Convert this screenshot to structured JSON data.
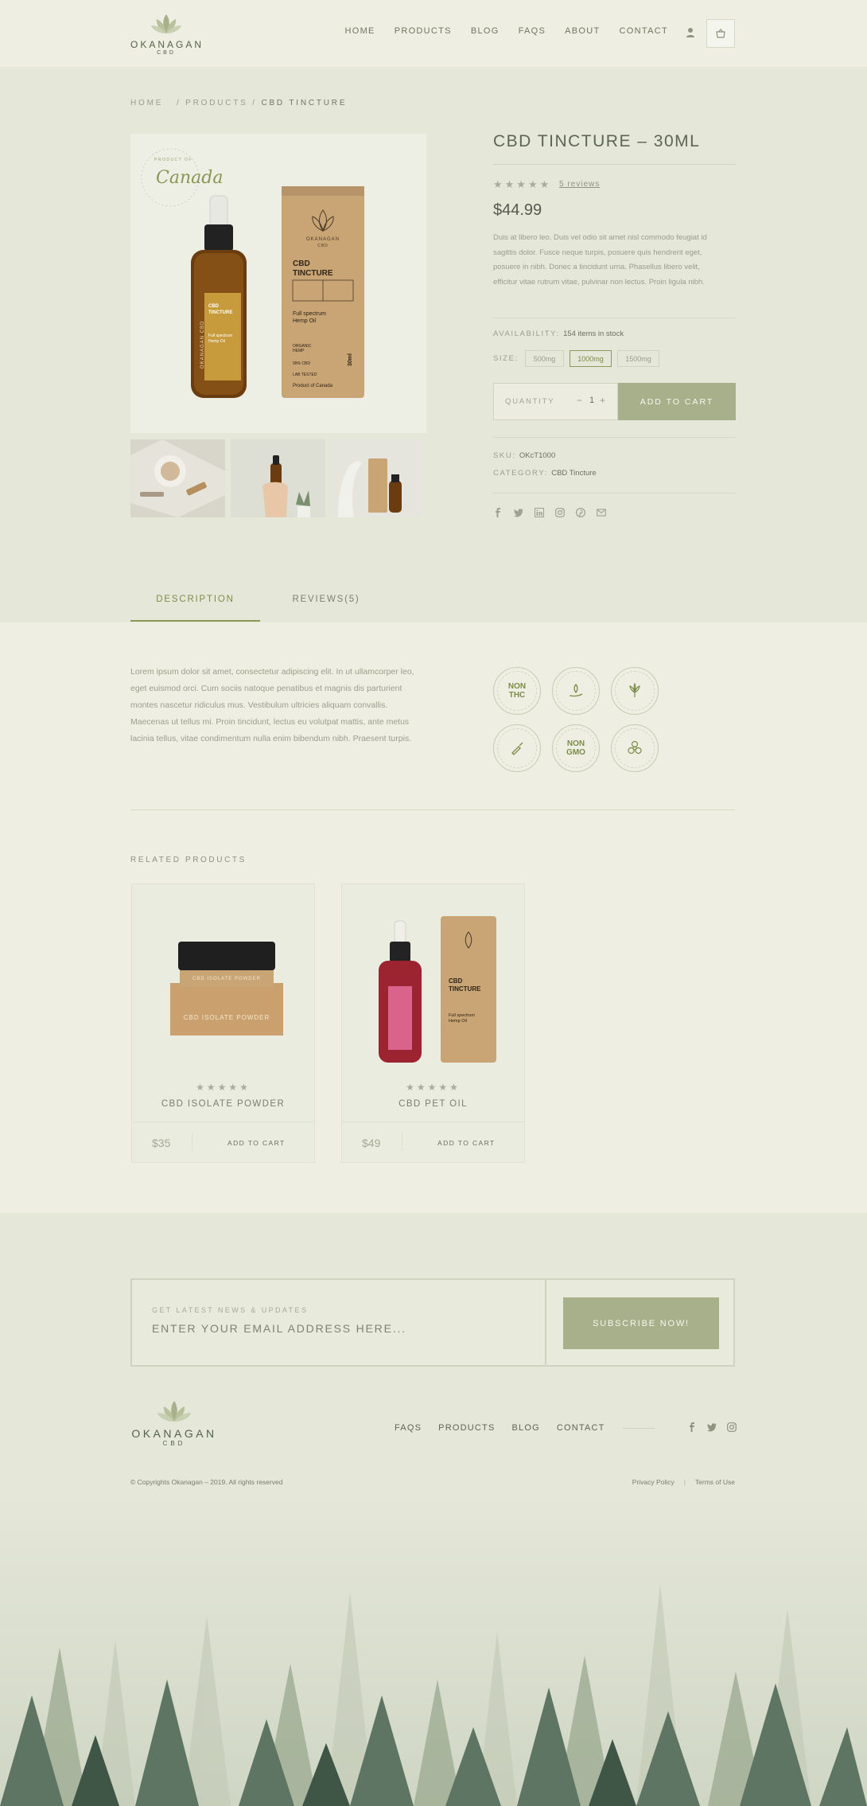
{
  "header": {
    "logo_word": "OKANAGAN",
    "logo_sub": "CBD",
    "nav": [
      "HOME",
      "PRODUCTS",
      "BLOG",
      "FAQS",
      "ABOUT",
      "CONTACT"
    ]
  },
  "breadcrumb": {
    "home": "HOME",
    "products": "PRODUCTS",
    "current": "CBD TINCTURE",
    "sep": "/"
  },
  "product": {
    "title": "CBD TINCTURE – 30ML",
    "stars": "★★★★★",
    "reviews_link": "5 reviews",
    "price": "$44.99",
    "short_description": "Duis at libero leo. Duis vel odio sit amet nisl commodo feugiat id sagittis dolor. Fusce neque turpis, posuere quis hendrerit eget, posuere in nibh. Donec a tincidunt urna. Phasellus libero velit, efficitur vitae rutrum vitae, pulvinar non lectus. Proin ligula nibh.",
    "availability_label": "AVAILABILITY:",
    "availability_value": "154 items in stock",
    "size_label": "SIZE:",
    "sizes": [
      "500mg",
      "1000mg",
      "1500mg"
    ],
    "selected_size": "1000mg",
    "quantity_label": "QUANTITY",
    "quantity": "1",
    "minus": "−",
    "plus": "+",
    "add_to_cart": "ADD TO CART",
    "sku_label": "SKU:",
    "sku_value": "OKcT1000",
    "category_label": "CATEGORY:",
    "category_value": "CBD Tincture",
    "image_stamp": "Canada",
    "stamp_top": "PRODUCT OF",
    "bottle_brand": "OKANAGAN CBD",
    "box_brand": "OKANAGAN",
    "box_sub": "CBD",
    "box_title_1": "CBD",
    "box_title_2": "TINCTURE",
    "box_desc_1": "Full spectrum",
    "box_desc_2": "Hemp Oil",
    "box_line_1": "ORGANIC",
    "box_line_1b": "HEMP",
    "box_line_2": "99% CBD",
    "box_line_3": "LAB TESTED",
    "box_volume": "30ml",
    "box_footer": "Product of Canada"
  },
  "tabs": {
    "description": "DESCRIPTION",
    "reviews": "REVIEWS(5)"
  },
  "long_description": "Lorem ipsum dolor sit amet, consectetur adipiscing elit. In ut ullamcorper leo, eget euismod orci. Cum sociis natoque penatibus et magnis dis parturient montes nascetur ridiculus mus. Vestibulum ultricies aliquam convallis. Maecenas ut tellus mi. Proin tincidunt, lectus eu volutpat mattis, ante metus lacinia tellus, vitae condimentum nulla enim bibendum nibh. Praesent turpis.",
  "badges": {
    "non_thc_1": "NON",
    "non_thc_2": "THC",
    "non_gmo_1": "NON",
    "non_gmo_2": "GMO"
  },
  "related": {
    "heading": "RELATED PRODUCTS",
    "items": [
      {
        "name": "CBD ISOLATE POWDER",
        "price": "$35",
        "stars": "★★★★★",
        "cart": "ADD TO CART",
        "jar_label": "CBD ISOLATE POWDER",
        "box_label": "CBD ISOLATE POWDER"
      },
      {
        "name": "CBD PET OIL",
        "price": "$49",
        "stars": "★★★★★",
        "cart": "ADD TO CART",
        "box_title_1": "CBD",
        "box_title_2": "TINCTURE",
        "box_desc_1": "Full spectrum",
        "box_desc_2": "Hemp Oil"
      }
    ]
  },
  "newsletter": {
    "label": "GET LATEST NEWS & UPDATES",
    "placeholder": "ENTER YOUR EMAIL ADDRESS HERE...",
    "button": "SUBSCRIBE NOW!"
  },
  "footer": {
    "nav": [
      "FAQS",
      "PRODUCTS",
      "BLOG",
      "CONTACT"
    ],
    "copyright": "© Copyrights Okanagan – 2019. All rights reserved",
    "privacy": "Privacy Policy",
    "pipe": "|",
    "terms": "Terms of Use"
  },
  "colors": {
    "accent": "#a7b08a",
    "accent_dark": "#7e8c4c",
    "page_bg": "#e5e7d8",
    "panel_bg": "#eeefe2"
  }
}
